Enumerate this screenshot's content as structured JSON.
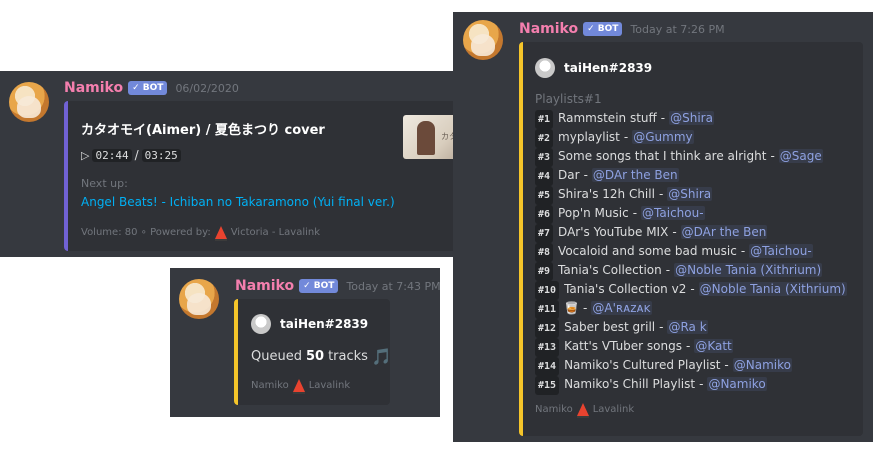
{
  "bot_badge": "✓ BOT",
  "bot_name": "Namiko",
  "colors": {
    "username": "#f47fae",
    "music_bar": "#7162d4",
    "queue_bar": "#f5c52a",
    "bot_badge": "#7289da",
    "link": "#00b0f4",
    "mention": "#8ea1e1"
  },
  "msg1": {
    "timestamp": "06/02/2020",
    "song_title": "カタオモイ(Aimer) / 夏色まつり cover",
    "play_icon": "play-icon",
    "time_current": "02:44",
    "time_sep": "/",
    "time_total": "03:25",
    "next_up_label": "Next up:",
    "next_up_track": "Angel Beats! - Ichiban no Takaramono (Yui final ver.)",
    "thumbnail_text": "カタオモイ",
    "footer_left": "Volume: 80 ∘ Powered by:",
    "footer_right": "Victoria - Lavalink"
  },
  "msg2": {
    "timestamp": "Today at 7:43 PM",
    "author": "taiHen#2839",
    "queued_prefix": "Queued",
    "queued_count": "50",
    "queued_suffix": "tracks",
    "note_icon": "🎵",
    "footer_left": "Namiko",
    "footer_right": "Lavalink"
  },
  "msg3": {
    "timestamp": "Today at 7:26 PM",
    "author": "taiHen#2839",
    "section_title": "Playlists#1",
    "playlists": [
      {
        "num": "#1",
        "name": "Rammstein stuff",
        "owner": "@Shira"
      },
      {
        "num": "#2",
        "name": "myplaylist",
        "owner": "@Gummy"
      },
      {
        "num": "#3",
        "name": "Some songs that I think are alright",
        "owner": "@Sage"
      },
      {
        "num": "#4",
        "name": "Dar",
        "owner": "@DAr the Ben"
      },
      {
        "num": "#5",
        "name": "Shira's 12h Chill",
        "owner": "@Shira"
      },
      {
        "num": "#6",
        "name": "Pop'n Music",
        "owner": "@Taichou-"
      },
      {
        "num": "#7",
        "name": "DAr's YouTube MIX",
        "owner": "@DAr the Ben"
      },
      {
        "num": "#8",
        "name": "Vocaloid and some bad music",
        "owner": "@Taichou-"
      },
      {
        "num": "#9",
        "name": "Tania's Collection",
        "owner": "@Noble Tania (Xithrium)"
      },
      {
        "num": "#10",
        "name": "Tania's Collection v2",
        "owner": "@Noble Tania (Xithrium)"
      },
      {
        "num": "#11",
        "name": "🥃",
        "owner": "@A'ʀᴀᴢᴀᴋ"
      },
      {
        "num": "#12",
        "name": "Saber best grill",
        "owner": "@Ra k"
      },
      {
        "num": "#13",
        "name": "Katt's VTuber songs",
        "owner": "@Katt"
      },
      {
        "num": "#14",
        "name": "Namiko's Cultured Playlist",
        "owner": "@Namiko"
      },
      {
        "num": "#15",
        "name": "Namiko's Chill Playlist",
        "owner": "@Namiko"
      }
    ],
    "separator": "-",
    "footer_left": "Namiko",
    "footer_right": "Lavalink"
  }
}
